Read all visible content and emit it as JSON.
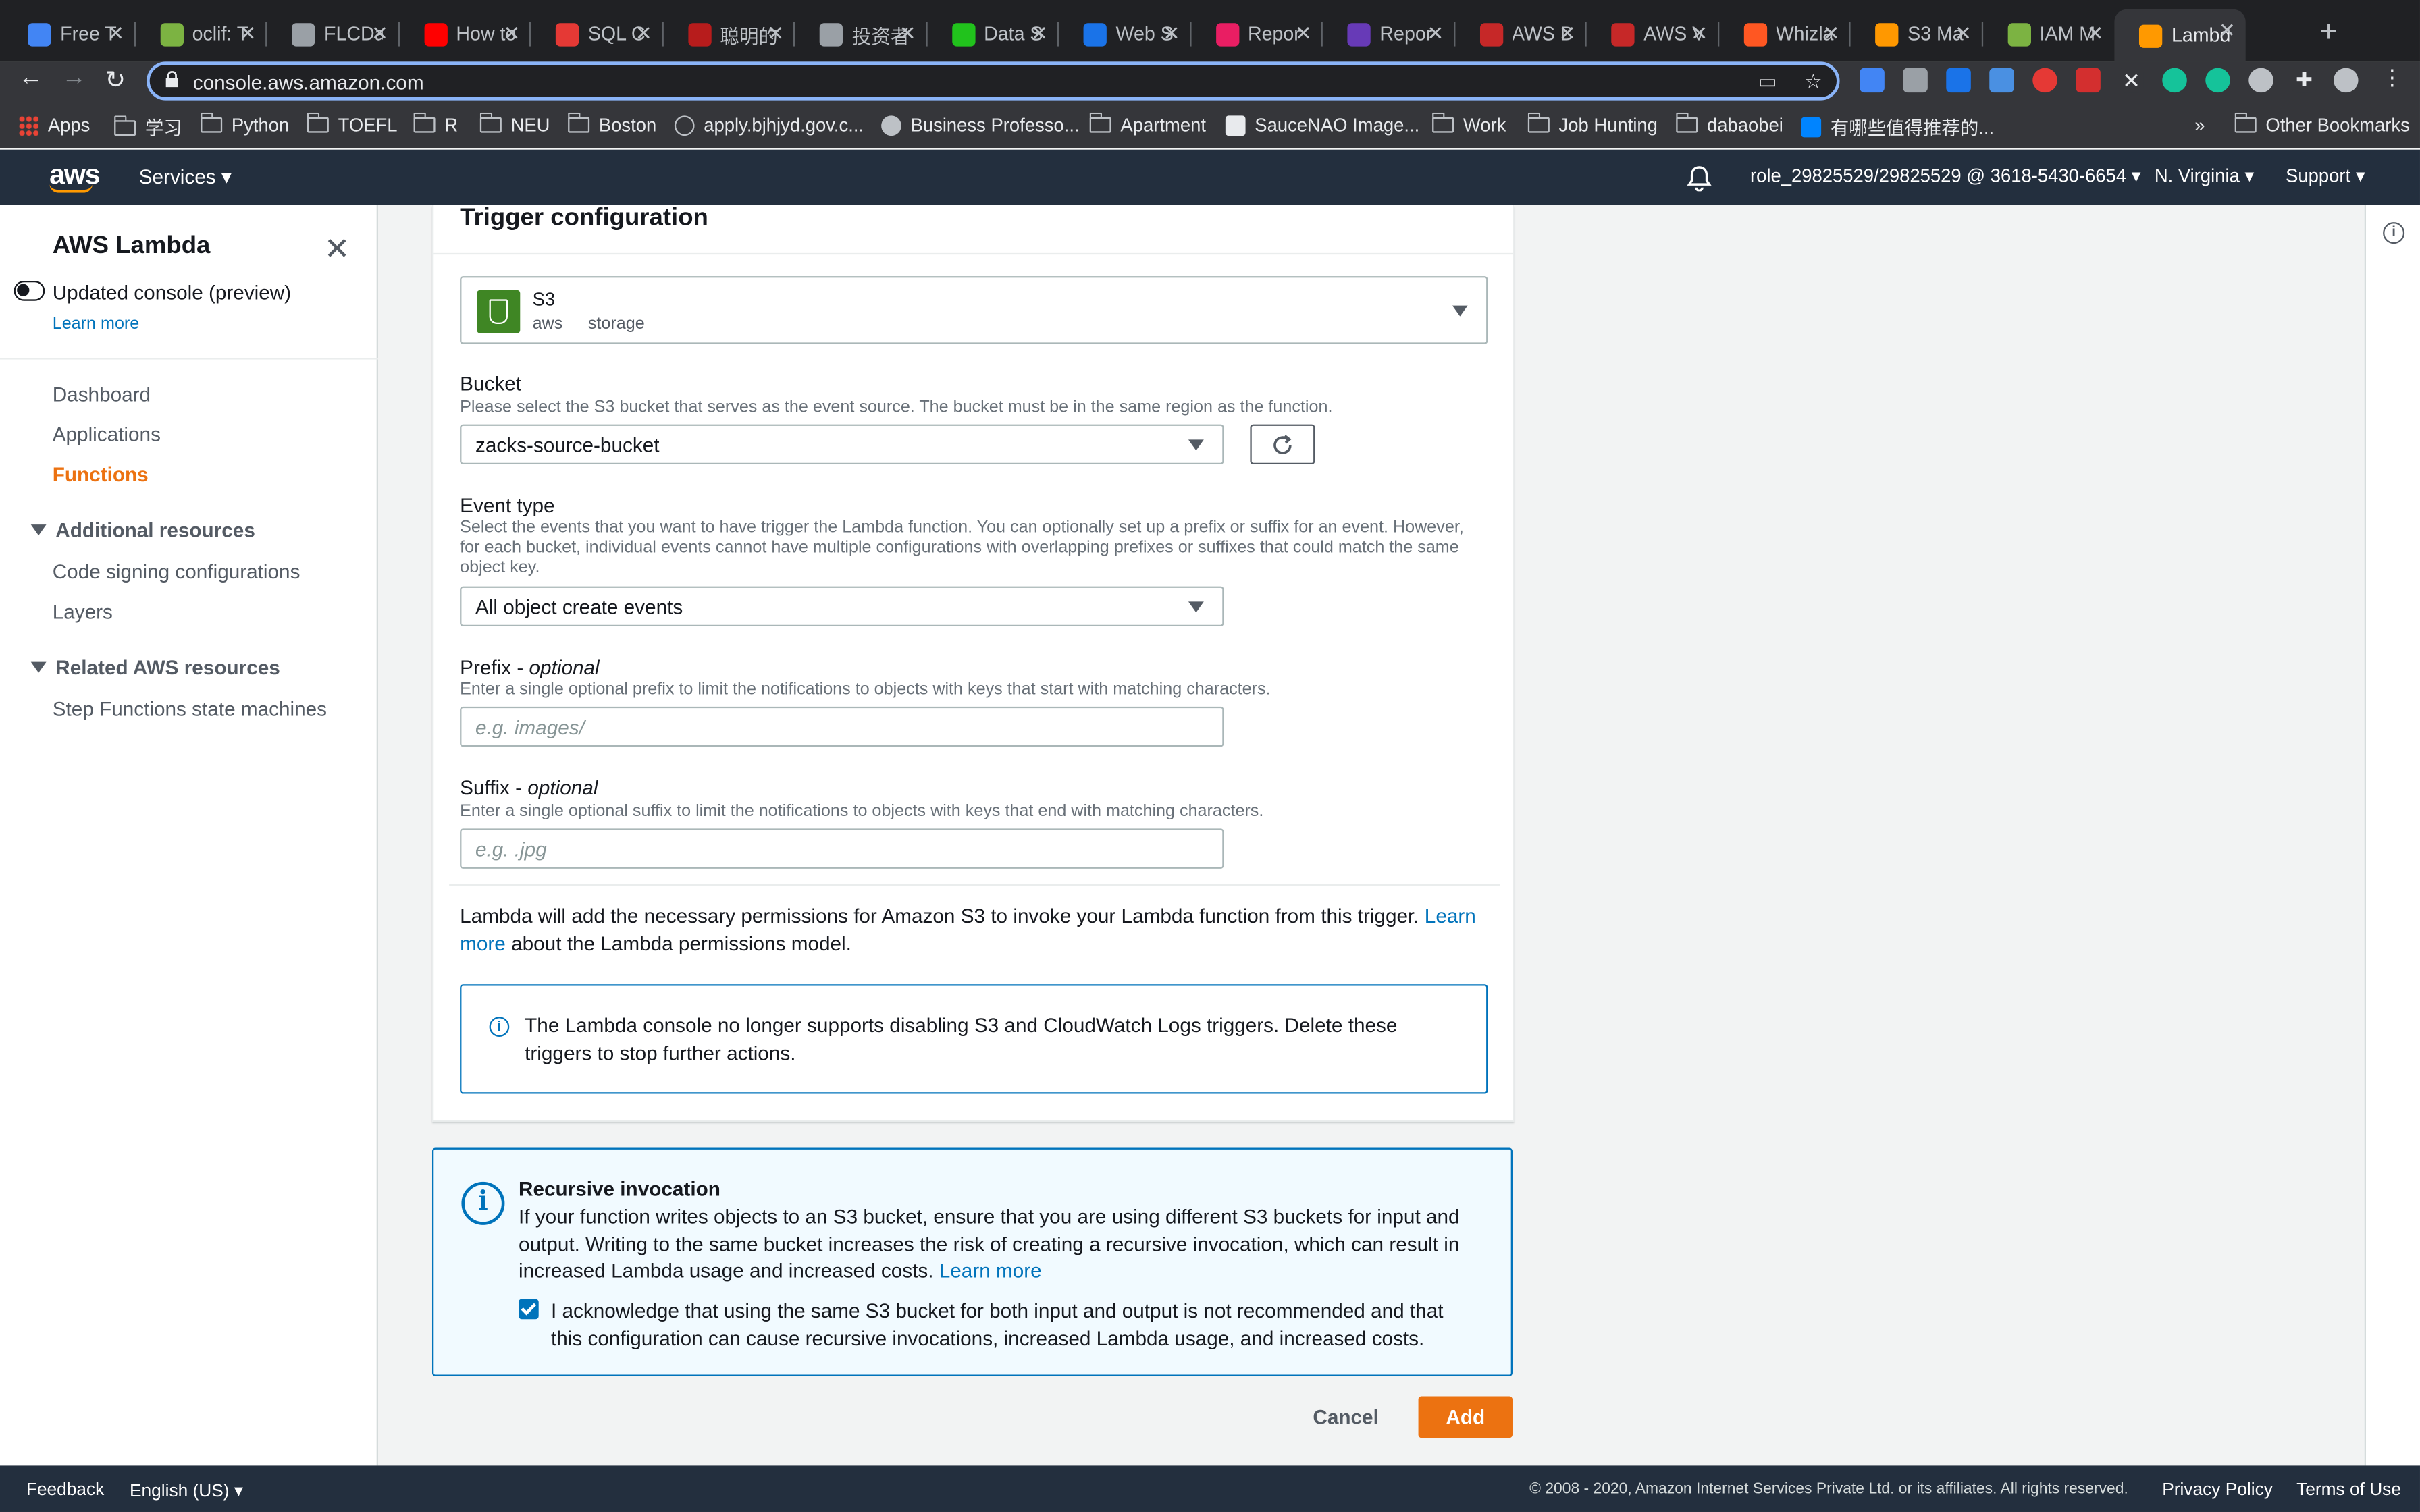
{
  "browser": {
    "tabs": [
      {
        "label": "Free T",
        "color": "#4285f4"
      },
      {
        "label": "oclif: T",
        "color": "#7cb342"
      },
      {
        "label": "FLCDa",
        "color": "#9aa0a6"
      },
      {
        "label": "How to",
        "color": "#ff0000"
      },
      {
        "label": "SQL C",
        "color": "#e53935"
      },
      {
        "label": "聪明的",
        "color": "#b71c1c"
      },
      {
        "label": "投资者",
        "color": "#9aa0a6"
      },
      {
        "label": "Data S",
        "color": "#21c21c"
      },
      {
        "label": "Web S",
        "color": "#1a73e8"
      },
      {
        "label": "Repor",
        "color": "#e91e63"
      },
      {
        "label": "Repor",
        "color": "#673ab7"
      },
      {
        "label": "AWS D",
        "color": "#c62828"
      },
      {
        "label": "AWS V",
        "color": "#c62828"
      },
      {
        "label": "Whizla",
        "color": "#ff5722"
      },
      {
        "label": "S3 Ma",
        "color": "#ff9800"
      },
      {
        "label": "IAM M",
        "color": "#7cb342"
      },
      {
        "label": "Lambd",
        "color": "#ff9900",
        "active": true
      }
    ],
    "url": "console.aws.amazon.com",
    "bookmarks": [
      "Apps",
      "学习",
      "Python",
      "TOEFL",
      "R",
      "NEU",
      "Boston",
      "apply.bjhjyd.gov.c...",
      "Business Professo...",
      "Apartment",
      "SauceNAO Image...",
      "Work",
      "Job Hunting",
      "dabaobei",
      "有哪些值得推荐的..."
    ],
    "more_bookmarks": "»",
    "other_bookmarks": "Other Bookmarks"
  },
  "header": {
    "logo": "aws",
    "services": "Services",
    "account": "role_29825529/29825529 @ 3618-5430-6654",
    "region": "N. Virginia",
    "support": "Support"
  },
  "sidebar": {
    "title": "AWS Lambda",
    "toggle_label": "Updated console (preview)",
    "learn_more": "Learn more",
    "items": [
      "Dashboard",
      "Applications",
      "Functions"
    ],
    "active_item": "Functions",
    "section1": "Additional resources",
    "section1_items": [
      "Code signing configurations",
      "Layers"
    ],
    "section2": "Related AWS resources",
    "section2_items": [
      "Step Functions state machines"
    ]
  },
  "form": {
    "title": "Trigger configuration",
    "trigger": {
      "name": "S3",
      "tag1": "aws",
      "tag2": "storage"
    },
    "bucket": {
      "label": "Bucket",
      "desc": "Please select the S3 bucket that serves as the event source. The bucket must be in the same region as the function.",
      "value": "zacks-source-bucket"
    },
    "event_type": {
      "label": "Event type",
      "desc": "Select the events that you want to have trigger the Lambda function. You can optionally set up a prefix or suffix for an event. However, for each bucket, individual events cannot have multiple configurations with overlapping prefixes or suffixes that could match the same object key.",
      "value": "All object create events"
    },
    "prefix": {
      "label": "Prefix - ",
      "optional": "optional",
      "desc": "Enter a single optional prefix to limit the notifications to objects with keys that start with matching characters.",
      "placeholder": "e.g. images/"
    },
    "suffix": {
      "label": "Suffix - ",
      "optional": "optional",
      "desc": "Enter a single optional suffix to limit the notifications to objects with keys that end with matching characters.",
      "placeholder": "e.g. .jpg"
    },
    "permissions_text": "Lambda will add the necessary permissions for Amazon S3 to invoke your Lambda function from this trigger. ",
    "permissions_link": "Learn more",
    "permissions_tail": " about the Lambda permissions model.",
    "info_text": "The Lambda console no longer supports disabling S3 and CloudWatch Logs triggers. Delete these triggers to stop further actions."
  },
  "recursive": {
    "title": "Recursive invocation",
    "body": "If your function writes objects to an S3 bucket, ensure that you are using different S3 buckets for input and output. Writing to the same bucket increases the risk of creating a recursive invocation, which can result in increased Lambda usage and increased costs. ",
    "link": "Learn more",
    "checkbox_label": "I acknowledge that using the same S3 bucket for both input and output is not recommended and that this configuration can cause recursive invocations, increased Lambda usage, and increased costs.",
    "checked": true
  },
  "actions": {
    "cancel": "Cancel",
    "add": "Add"
  },
  "footer": {
    "feedback": "Feedback",
    "language": "English (US)",
    "copyright": "© 2008 - 2020, Amazon Internet Services Private Ltd. or its affiliates. All rights reserved.",
    "privacy": "Privacy Policy",
    "terms": "Terms of Use"
  },
  "colors": {
    "accent": "#ec7211",
    "link": "#0073bb",
    "header": "#232f3e",
    "info_bg": "#f1faff"
  }
}
